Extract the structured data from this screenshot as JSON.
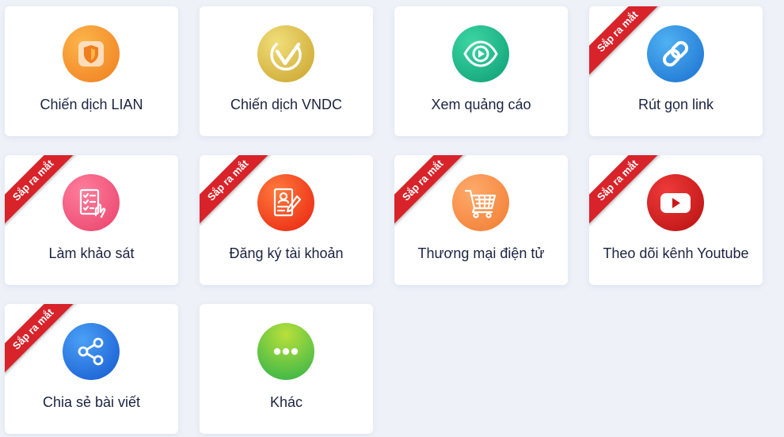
{
  "badge_text": "Sắp ra mắt",
  "cards": [
    {
      "label": "Chiến dịch LIAN",
      "icon": "shield-icon",
      "coming_soon": false,
      "color": "#f28a2b"
    },
    {
      "label": "Chiến dịch VNDC",
      "icon": "vndc-logo-icon",
      "coming_soon": false,
      "color": "#d8b93a"
    },
    {
      "label": "Xem quảng cáo",
      "icon": "eye-icon",
      "coming_soon": false,
      "color": "#1fb38a"
    },
    {
      "label": "Rút gọn link",
      "icon": "link-icon",
      "coming_soon": true,
      "color": "#2a8fe0"
    },
    {
      "label": "Làm khảo sát",
      "icon": "survey-icon",
      "coming_soon": true,
      "color": "#f0577e"
    },
    {
      "label": "Đăng ký tài khoản",
      "icon": "register-form-icon",
      "coming_soon": true,
      "color": "#f24a1e"
    },
    {
      "label": "Thương mại điện tử",
      "icon": "shopping-cart-icon",
      "coming_soon": true,
      "color": "#f5893f"
    },
    {
      "label": "Theo dõi kênh Youtube",
      "icon": "youtube-icon",
      "coming_soon": true,
      "color": "#cc1a1a"
    },
    {
      "label": "Chia sẻ bài viết",
      "icon": "share-icon",
      "coming_soon": true,
      "color": "#2672e0"
    },
    {
      "label": "Khác",
      "icon": "more-dots-icon",
      "coming_soon": false,
      "color": "#4bbf3c"
    }
  ]
}
